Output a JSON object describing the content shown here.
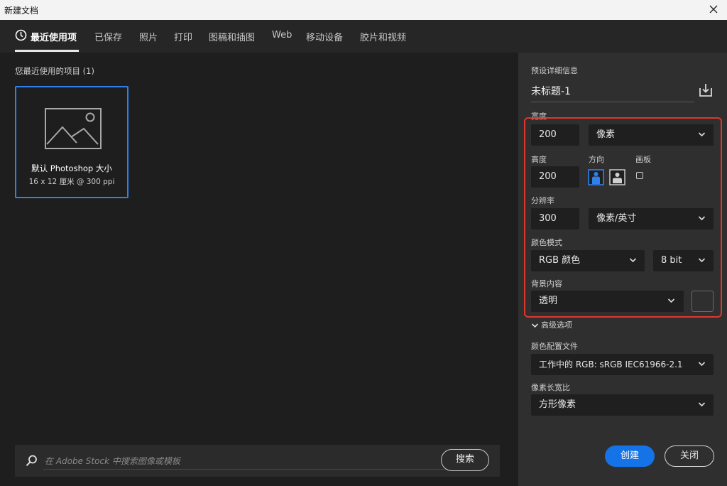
{
  "window": {
    "title": "新建文档"
  },
  "tabs": [
    {
      "label": "最近使用项"
    },
    {
      "label": "已保存"
    },
    {
      "label": "照片"
    },
    {
      "label": "打印"
    },
    {
      "label": "图稿和插图"
    },
    {
      "label": "Web"
    },
    {
      "label": "移动设备"
    },
    {
      "label": "胶片和视频"
    }
  ],
  "recent": {
    "label": "您最近使用的项目 (1)",
    "preset": {
      "name": "默认 Photoshop 大小",
      "size": "16 x 12 厘米 @ 300 ppi"
    }
  },
  "search": {
    "placeholder": "在 Adobe Stock 中搜索图像或模板",
    "button": "搜索"
  },
  "details": {
    "section_label": "预设详细信息",
    "doc_name": "未标题-1",
    "width_label": "宽度",
    "width_value": "200",
    "width_unit": "像素",
    "height_label": "高度",
    "height_value": "200",
    "orientation_label": "方向",
    "artboard_label": "画板",
    "resolution_label": "分辨率",
    "resolution_value": "300",
    "resolution_unit": "像素/英寸",
    "color_mode_label": "颜色模式",
    "color_mode_value": "RGB 颜色",
    "bit_depth": "8 bit",
    "background_label": "背景内容",
    "background_value": "透明",
    "advanced_label": "高级选项",
    "color_profile_label": "颜色配置文件",
    "color_profile_value": "工作中的 RGB: sRGB IEC61966-2.1",
    "pixel_aspect_label": "像素长宽比",
    "pixel_aspect_value": "方形像素"
  },
  "actions": {
    "create": "创建",
    "close": "关闭"
  },
  "colors": {
    "accent": "#1473e6",
    "highlight": "#e0362c",
    "selected_border": "#2f80ed"
  }
}
